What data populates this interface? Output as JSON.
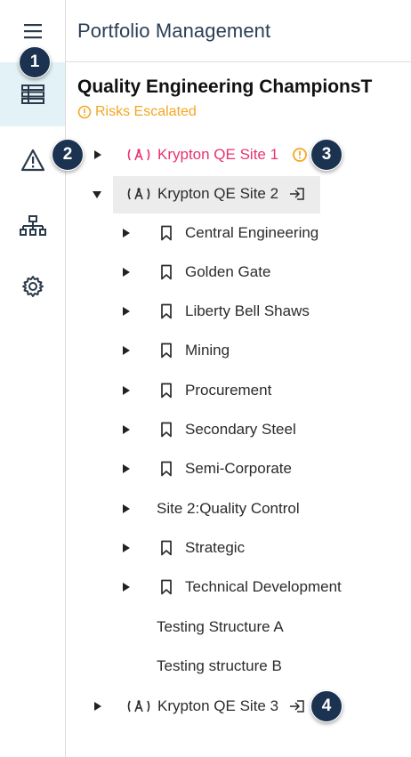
{
  "header": {
    "title": "Portfolio Management"
  },
  "portfolio": {
    "title": "Quality Engineering ChampionsT",
    "status": "Risks Escalated"
  },
  "tree": {
    "site1": "Krypton QE Site 1",
    "site2": "Krypton QE Site 2",
    "site3": "Krypton QE Site 3",
    "children": [
      "Central Engineering",
      "Golden Gate",
      "Liberty Bell Shaws",
      "Mining",
      "Procurement",
      "Secondary Steel",
      "Semi-Corporate",
      "Site 2:Quality Control",
      "Strategic",
      "Technical Development",
      "Testing Structure A",
      "Testing structure B"
    ]
  },
  "callouts": [
    "1",
    "2",
    "3",
    "4"
  ],
  "colors": {
    "accent_risk": "#f5a623",
    "site_at_risk": "#e8336d",
    "callout_bg": "#1b3350",
    "rail_active": "#e3f2f6"
  },
  "icons": [
    "menu-icon",
    "list-view-icon",
    "warning-icon",
    "hierarchy-icon",
    "settings-icon",
    "radio-tower-icon",
    "bookmark-icon",
    "exclamation-circle-icon",
    "link-out-icon"
  ]
}
